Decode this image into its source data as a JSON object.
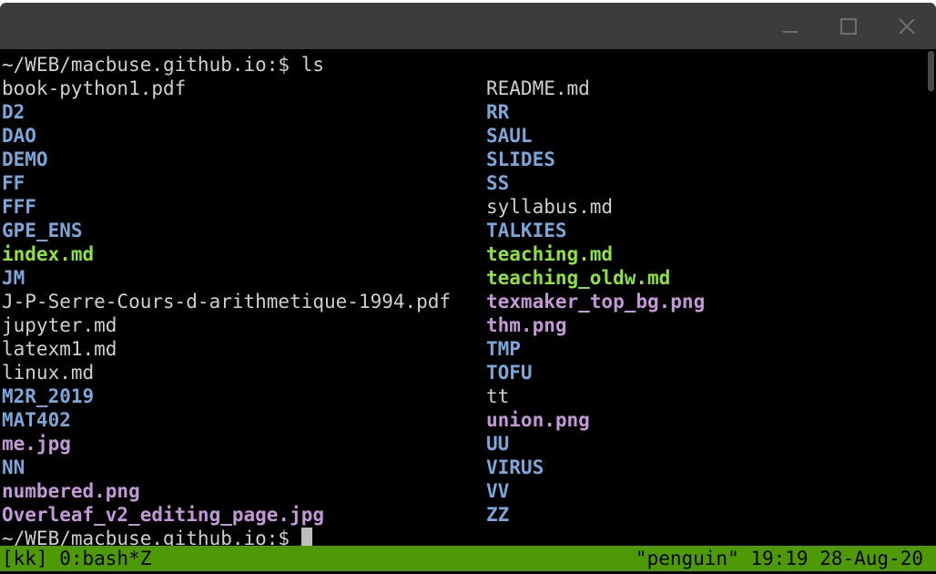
{
  "window": {
    "controls": {
      "minimize_icon": "minimize-icon",
      "maximize_icon": "maximize-icon",
      "close_icon": "close-icon"
    }
  },
  "terminal": {
    "command_line": "~/WEB/macbuse.github.io:$ ls",
    "prompt": "~/WEB/macbuse.github.io:$ ",
    "colors": {
      "plain": "#cfcfcf",
      "directory": "#7aa6da",
      "executable": "#8fe23b",
      "image": "#c397d8",
      "background": "#000000"
    },
    "rows": [
      {
        "left": {
          "text": "book-python1.pdf",
          "kind": "plain"
        },
        "right": {
          "text": "README.md",
          "kind": "plain"
        }
      },
      {
        "left": {
          "text": "D2",
          "kind": "dir"
        },
        "right": {
          "text": "RR",
          "kind": "dir"
        }
      },
      {
        "left": {
          "text": "DAO",
          "kind": "dir"
        },
        "right": {
          "text": "SAUL",
          "kind": "dir"
        }
      },
      {
        "left": {
          "text": "DEMO",
          "kind": "dir"
        },
        "right": {
          "text": "SLIDES",
          "kind": "dir"
        }
      },
      {
        "left": {
          "text": "FF",
          "kind": "dir"
        },
        "right": {
          "text": "SS",
          "kind": "dir"
        }
      },
      {
        "left": {
          "text": "FFF",
          "kind": "dir"
        },
        "right": {
          "text": "syllabus.md",
          "kind": "plain"
        }
      },
      {
        "left": {
          "text": "GPE_ENS",
          "kind": "dir"
        },
        "right": {
          "text": "TALKIES",
          "kind": "dir"
        }
      },
      {
        "left": {
          "text": "index.md",
          "kind": "exec"
        },
        "right": {
          "text": "teaching.md",
          "kind": "exec"
        }
      },
      {
        "left": {
          "text": "JM",
          "kind": "dir"
        },
        "right": {
          "text": "teaching_oldw.md",
          "kind": "exec"
        }
      },
      {
        "left": {
          "text": "J-P-Serre-Cours-d-arithmetique-1994.pdf",
          "kind": "plain"
        },
        "right": {
          "text": "texmaker_top_bg.png",
          "kind": "img"
        }
      },
      {
        "left": {
          "text": "jupyter.md",
          "kind": "plain"
        },
        "right": {
          "text": "thm.png",
          "kind": "img"
        }
      },
      {
        "left": {
          "text": "latexm1.md",
          "kind": "plain"
        },
        "right": {
          "text": "TMP",
          "kind": "dir"
        }
      },
      {
        "left": {
          "text": "linux.md",
          "kind": "plain"
        },
        "right": {
          "text": "TOFU",
          "kind": "dir"
        }
      },
      {
        "left": {
          "text": "M2R_2019",
          "kind": "dir"
        },
        "right": {
          "text": "tt",
          "kind": "plain"
        }
      },
      {
        "left": {
          "text": "MAT402",
          "kind": "dir"
        },
        "right": {
          "text": "union.png",
          "kind": "img"
        }
      },
      {
        "left": {
          "text": "me.jpg",
          "kind": "img"
        },
        "right": {
          "text": "UU",
          "kind": "dir"
        }
      },
      {
        "left": {
          "text": "NN",
          "kind": "dir"
        },
        "right": {
          "text": "VIRUS",
          "kind": "dir"
        }
      },
      {
        "left": {
          "text": "numbered.png",
          "kind": "img"
        },
        "right": {
          "text": "VV",
          "kind": "dir"
        }
      },
      {
        "left": {
          "text": "Overleaf_v2_editing_page.jpg",
          "kind": "img"
        },
        "right": {
          "text": "ZZ",
          "kind": "dir"
        }
      }
    ]
  },
  "statusbar": {
    "left": "[kk] 0:bash*Z",
    "right": "\"penguin\" 19:19 28-Aug-20",
    "background": "#4e9a06"
  }
}
